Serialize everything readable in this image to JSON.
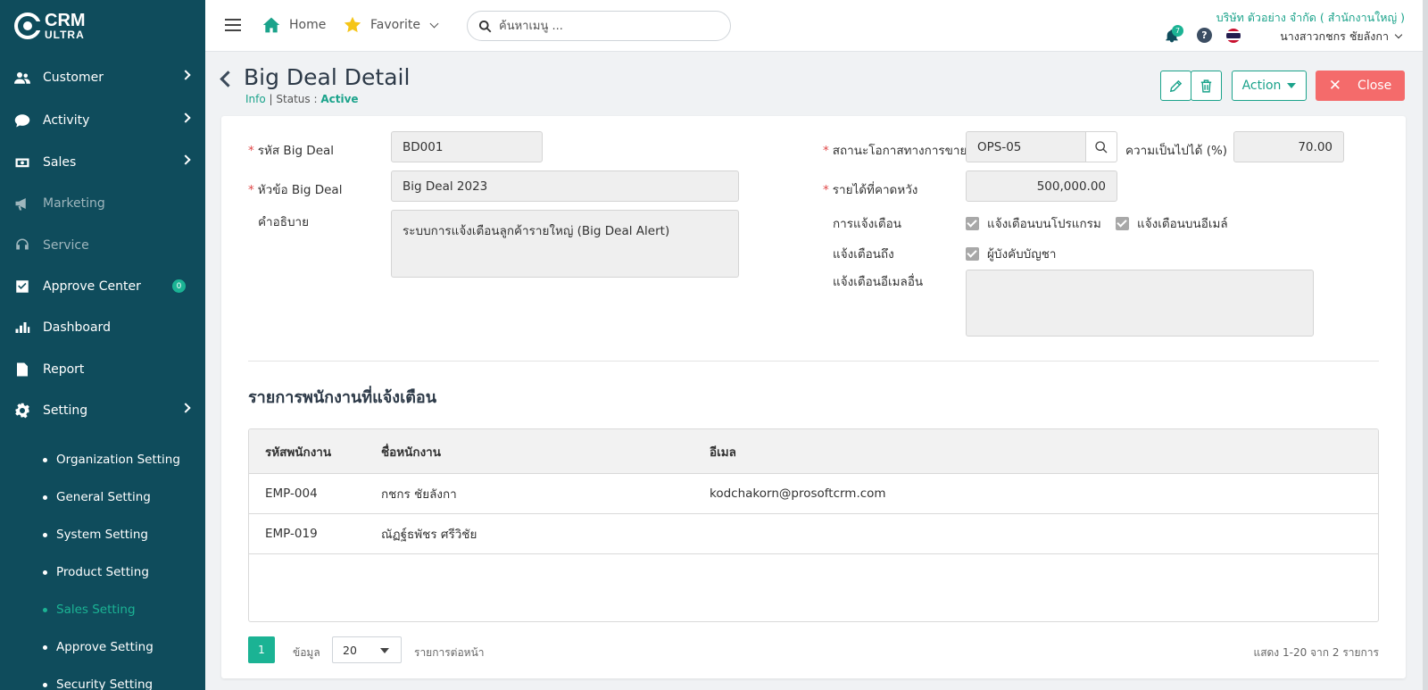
{
  "app": {
    "logo_line1": "CRM",
    "logo_line2": "ULTRA"
  },
  "sidebar": {
    "items": [
      {
        "label": "Customer",
        "icon": "users-icon"
      },
      {
        "label": "Activity",
        "icon": "chat-icon"
      },
      {
        "label": "Sales",
        "icon": "cash-icon"
      },
      {
        "label": "Marketing",
        "icon": "megaphone-icon"
      },
      {
        "label": "Service",
        "icon": "headset-icon"
      },
      {
        "label": "Approve Center",
        "icon": "check-square-icon",
        "count": "0"
      },
      {
        "label": "Dashboard",
        "icon": "bar-chart-icon"
      },
      {
        "label": "Report",
        "icon": "file-icon"
      },
      {
        "label": "Setting",
        "icon": "gear-icon"
      }
    ],
    "settings_sub": [
      "Organization Setting",
      "General Setting",
      "System Setting",
      "Product Setting",
      "Sales Setting",
      "Approve Setting",
      "Security Setting"
    ],
    "active_sub": "Sales Setting"
  },
  "topbar": {
    "home": "Home",
    "favorite": "Favorite",
    "search_placeholder": "ค้นหาเมนู ...",
    "company": "บริษัท ตัวอย่าง จำกัด ( สำนักงานใหญ่ )",
    "notification_count": "7",
    "help": "?",
    "user_name": "นางสาวกชกร ชัยลังกา"
  },
  "page": {
    "title": "Big Deal Detail",
    "info": "Info",
    "status_label": "| Status :",
    "status_value": "Active",
    "action_label": "Action",
    "close_label": "Close"
  },
  "form": {
    "code_label": "รหัส Big Deal",
    "code_value": "BD001",
    "subject_label": "หัวข้อ Big Deal",
    "subject_value": "Big Deal 2023",
    "desc_label": "คำอธิบาย",
    "desc_value": "ระบบการแจ้งเตือนลูกค้ารายใหญ่ (Big Deal Alert)",
    "opp_status_label": "สถานะโอกาสทางการขาย",
    "opp_status_value": "OPS-05",
    "probability_label": "ความเป็นไปได้ (%)",
    "probability_value": "70.00",
    "expected_revenue_label": "รายได้ที่คาดหวัง",
    "expected_revenue_value": "500,000.00",
    "notify_label": "การแจ้งเตือน",
    "notify_program": "แจ้งเตือนบนโปรแกรม",
    "notify_email": "แจ้งเตือนบนอีเมล์",
    "notify_to_label": "แจ้งเตือนถึง",
    "notify_to_value": "ผู้บังคับบัญชา",
    "other_email_label": "แจ้งเตือนอีเมลอื่น",
    "other_email_value": ""
  },
  "employees": {
    "title": "รายการพนักงานที่แจ้งเตือน",
    "columns": [
      "รหัสพนักงาน",
      "ชื่อหนักงาน",
      "อีเมล"
    ],
    "rows": [
      [
        "EMP-004",
        "กชกร ชัยลังกา",
        "kodchakorn@prosoftcrm.com"
      ],
      [
        "EMP-019",
        "ณัฏฐ์ธพัชร ศรีวิชัย",
        ""
      ]
    ]
  },
  "pager": {
    "page": "1",
    "data_label": "ข้อมูล",
    "page_size": "20",
    "per_page_label": "รายการต่อหน้า",
    "summary": "แสดง 1-20 จาก 2 รายการ"
  },
  "colors": {
    "sidebar": "#0f4c5c",
    "accent": "#1bb394",
    "close": "#f46b6b"
  }
}
